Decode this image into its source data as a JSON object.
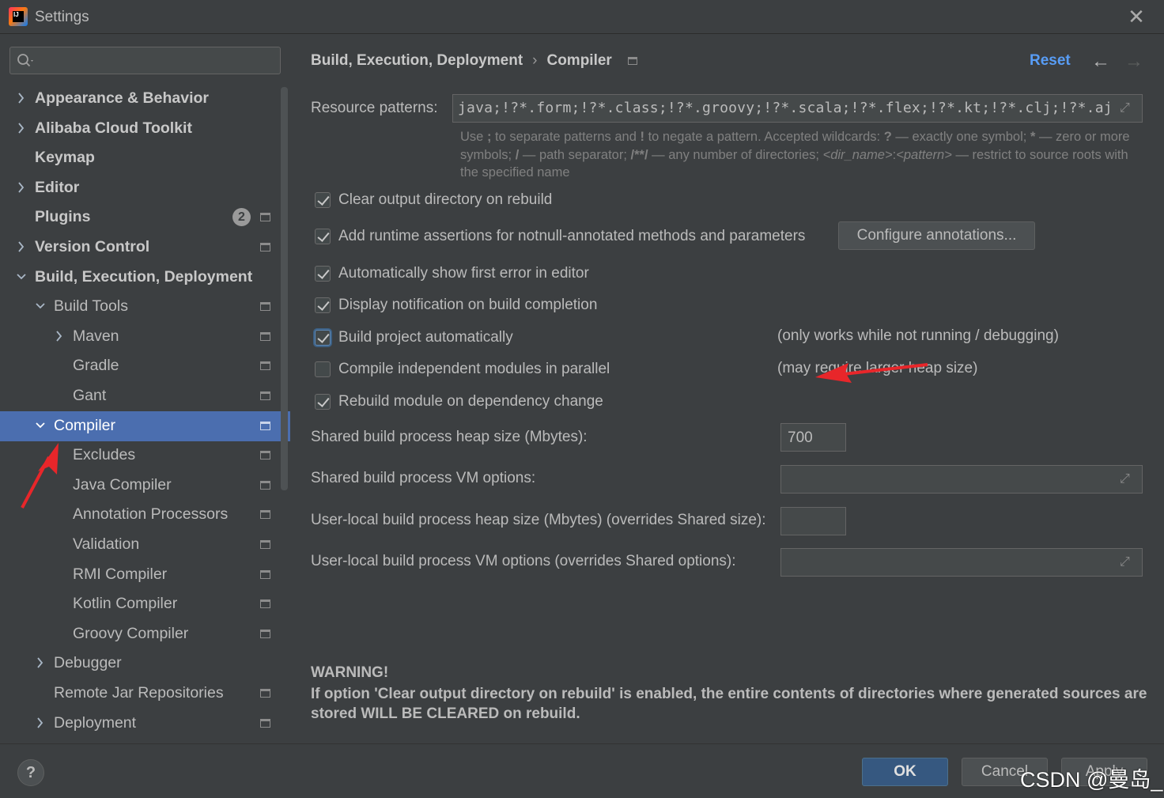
{
  "window": {
    "title": "Settings"
  },
  "sidebar": {
    "search_placeholder": "",
    "items": [
      {
        "label": "Appearance & Behavior",
        "arrow": "›"
      },
      {
        "label": "Alibaba Cloud Toolkit",
        "arrow": "›"
      },
      {
        "label": "Keymap",
        "arrow": ""
      },
      {
        "label": "Editor",
        "arrow": "›"
      },
      {
        "label": "Plugins",
        "arrow": "",
        "badge": "2"
      },
      {
        "label": "Version Control",
        "arrow": "›"
      },
      {
        "label": "Build, Execution, Deployment",
        "arrow": "⌄"
      },
      {
        "label": "Build Tools",
        "arrow": "⌄"
      },
      {
        "label": "Maven",
        "arrow": "›"
      },
      {
        "label": "Gradle",
        "arrow": ""
      },
      {
        "label": "Gant",
        "arrow": ""
      },
      {
        "label": "Compiler",
        "arrow": "⌄"
      },
      {
        "label": "Excludes",
        "arrow": ""
      },
      {
        "label": "Java Compiler",
        "arrow": ""
      },
      {
        "label": "Annotation Processors",
        "arrow": ""
      },
      {
        "label": "Validation",
        "arrow": ""
      },
      {
        "label": "RMI Compiler",
        "arrow": ""
      },
      {
        "label": "Kotlin Compiler",
        "arrow": ""
      },
      {
        "label": "Groovy Compiler",
        "arrow": ""
      },
      {
        "label": "Debugger",
        "arrow": "›"
      },
      {
        "label": "Remote Jar Repositories",
        "arrow": ""
      },
      {
        "label": "Deployment",
        "arrow": "›"
      }
    ]
  },
  "header": {
    "crumb_parent": "Build, Execution, Deployment",
    "crumb_sep": "›",
    "crumb_current": "Compiler",
    "reset_label": "Reset",
    "back_glyph": "←",
    "forward_glyph": "→"
  },
  "resource": {
    "label": "Resource patterns:",
    "value": "java;!?*.form;!?*.class;!?*.groovy;!?*.scala;!?*.flex;!?*.kt;!?*.clj;!?*.aj",
    "hint_1": "Use ",
    "hint_semicolon": ";",
    "hint_2": " to separate patterns and ",
    "hint_bang": "!",
    "hint_3": " to negate a pattern. Accepted wildcards: ",
    "hint_q": "?",
    "hint_4": " — exactly one symbol; ",
    "hint_star": "*",
    "hint_5": " — zero or more symbols; ",
    "hint_slash": "/",
    "hint_6": " — path separator; ",
    "hint_dstar": "/**/",
    "hint_7": " — any number of directories; ",
    "hint_dir": "<dir_name>",
    "hint_colon": ":",
    "hint_pattern": "<pattern>",
    "hint_8": " — restrict to source roots with the specified name"
  },
  "options": {
    "clear_output": {
      "label": "Clear output directory on rebuild",
      "checked": true
    },
    "runtime_assertions": {
      "label": "Add runtime assertions for notnull-annotated methods and parameters",
      "checked": true
    },
    "configure_button": "Configure annotations...",
    "show_first_error": {
      "label": "Automatically show first error in editor",
      "checked": true
    },
    "build_notification": {
      "label": "Display notification on build completion",
      "checked": true
    },
    "build_auto": {
      "label": "Build project automatically",
      "checked": true,
      "note": "(only works while not running / debugging)"
    },
    "parallel": {
      "label": "Compile independent modules in parallel",
      "checked": false,
      "note": "(may require larger heap size)"
    },
    "rebuild_dep": {
      "label": "Rebuild module on dependency change",
      "checked": true
    }
  },
  "process": {
    "shared_heap_label": "Shared build process heap size (Mbytes):",
    "shared_heap_value": "700",
    "shared_vm_label": "Shared build process VM options:",
    "shared_vm_value": "",
    "user_heap_label": "User-local build process heap size (Mbytes) (overrides Shared size):",
    "user_heap_value": "",
    "user_vm_label": "User-local build process VM options (overrides Shared options):",
    "user_vm_value": ""
  },
  "warning": {
    "title": "WARNING!",
    "text": "If option 'Clear output directory on rebuild' is enabled, the entire contents of directories where generated sources are stored WILL BE CLEARED on rebuild."
  },
  "footer": {
    "help": "?",
    "ok": "OK",
    "cancel": "Cancel",
    "apply": "Apply",
    "watermark": "CSDN @曼岛_"
  },
  "colors": {
    "background": "#3c3f41",
    "selection": "#4b6eaf",
    "link": "#589df6",
    "ok_button": "#365880",
    "annotation_arrow": "#e8262a"
  }
}
